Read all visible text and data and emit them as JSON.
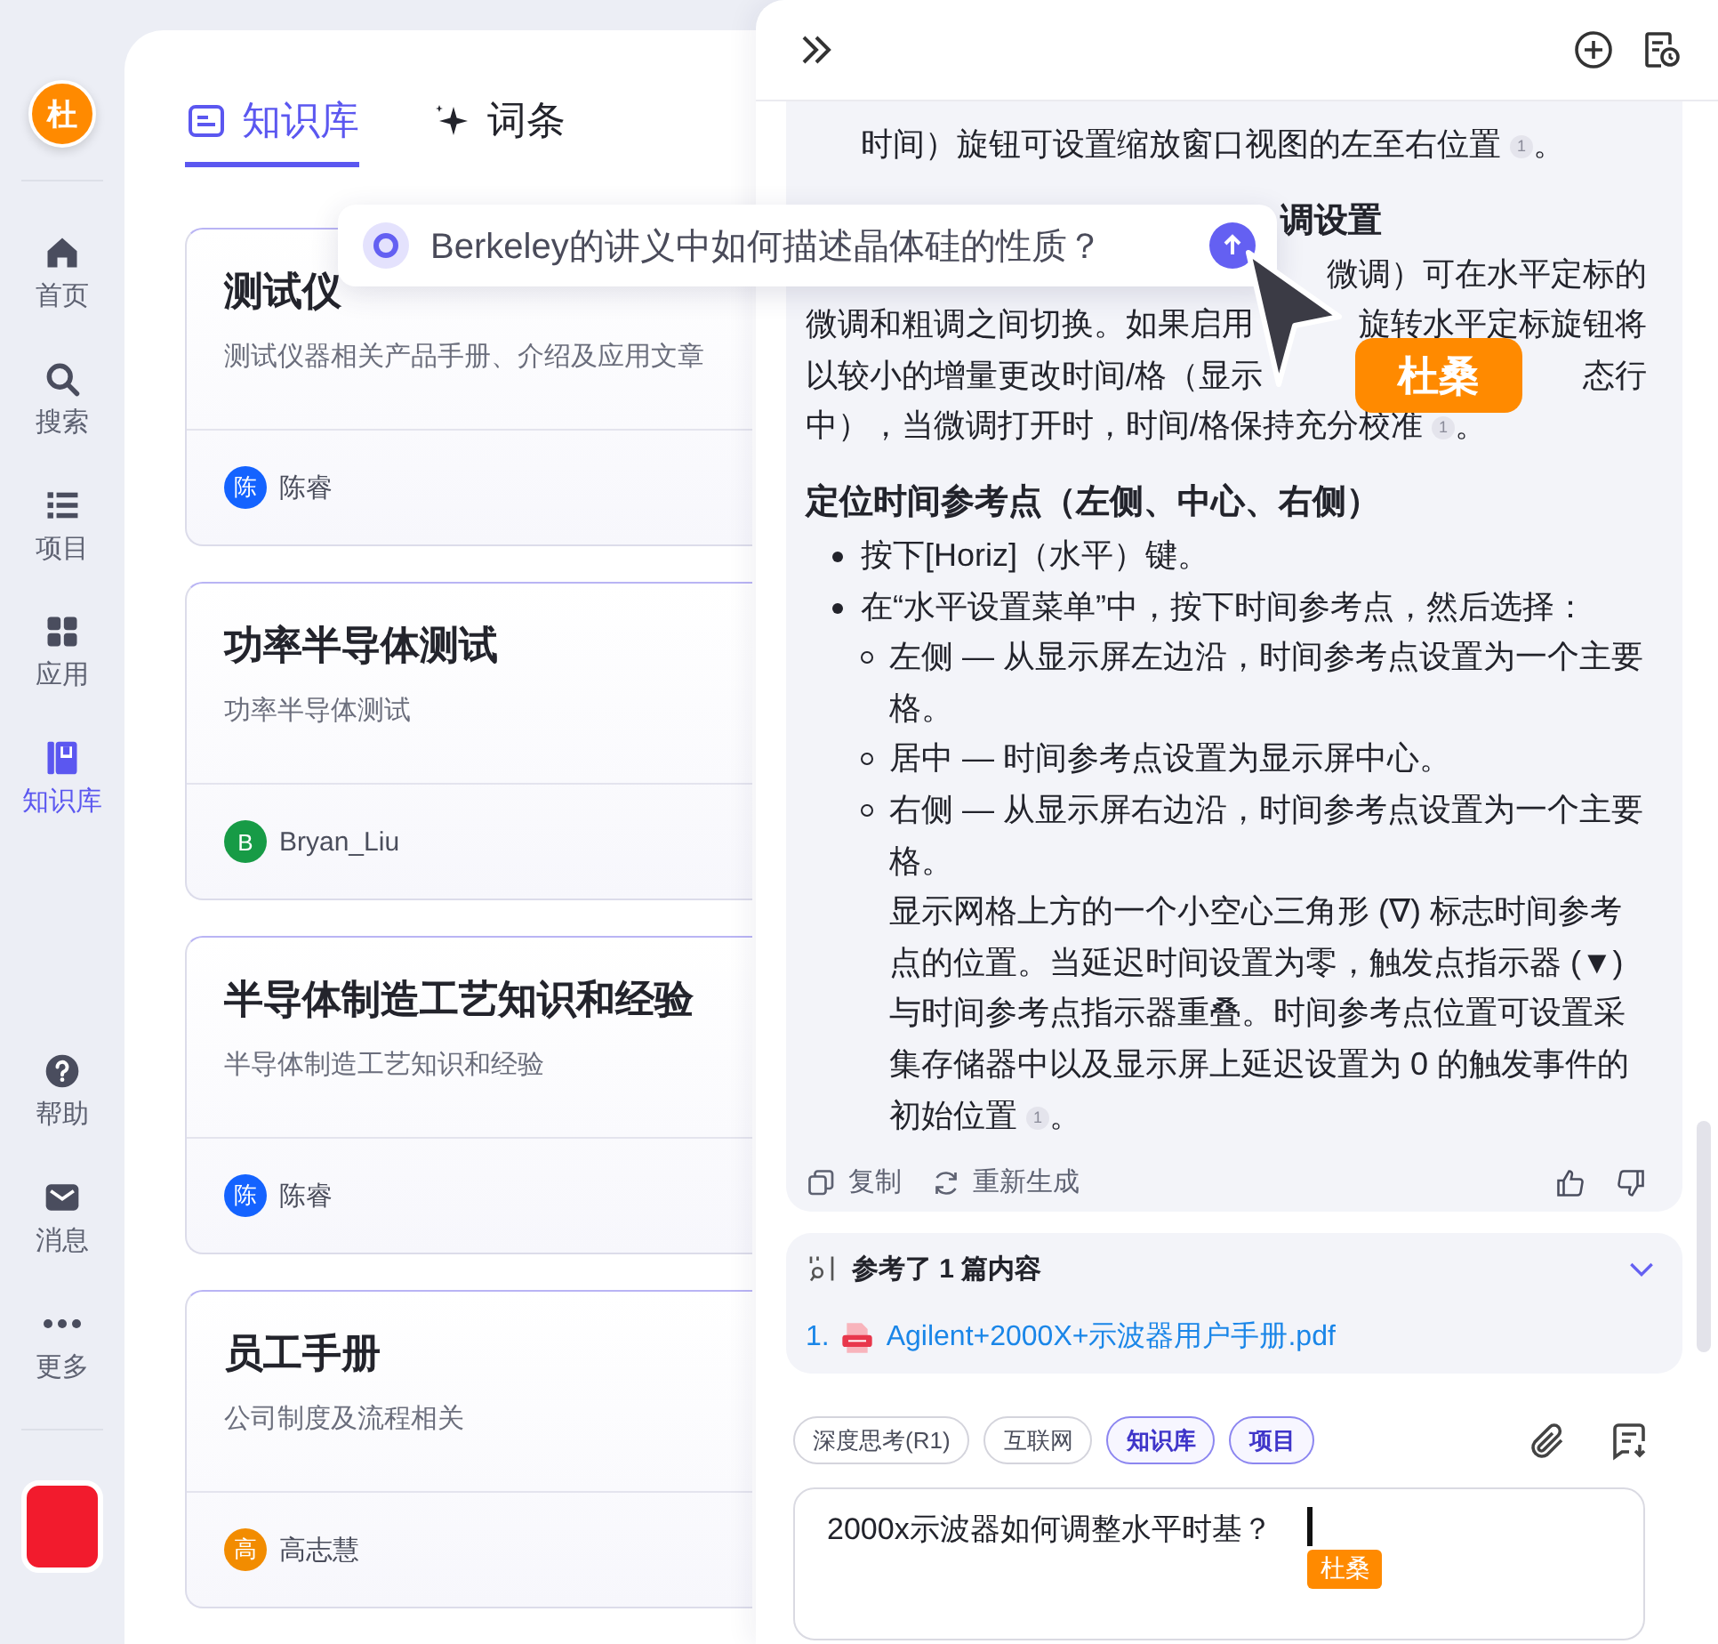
{
  "nav": {
    "avatar": "杜",
    "items": [
      {
        "label": "首页",
        "selected": false
      },
      {
        "label": "搜索",
        "selected": false
      },
      {
        "label": "项目",
        "selected": false
      },
      {
        "label": "应用",
        "selected": false
      },
      {
        "label": "知识库",
        "selected": true
      }
    ],
    "bottom_items": [
      {
        "label": "帮助",
        "selected": false
      },
      {
        "label": "消息",
        "selected": false
      },
      {
        "label": "更多",
        "selected": false
      }
    ]
  },
  "main": {
    "tabs": [
      {
        "label": "知识库",
        "selected": true
      },
      {
        "label": "词条",
        "selected": false
      }
    ],
    "cards": [
      {
        "title": "测试仪",
        "description": "测试仪器相关产品手册、介绍及应用文章",
        "owner_initial": "陈",
        "owner": "陈睿",
        "color": "#1463ff"
      },
      {
        "title": "功率半导体测试",
        "description": "功率半导体测试",
        "owner_initial": "B",
        "owner": "Bryan_Liu",
        "color": "#179b46"
      },
      {
        "title": "半导体制造工艺知识和经验",
        "description": "半导体制造工艺知识和经验",
        "owner_initial": "陈",
        "owner": "陈睿",
        "color": "#1463ff"
      },
      {
        "title": "员工手册",
        "description": "公司制度及流程相关",
        "owner_initial": "高",
        "owner": "高志慧",
        "color": "#f28c00"
      }
    ]
  },
  "popup": {
    "query": "Berkeley的讲义中如何描述晶体硅的性质？"
  },
  "pointer": {
    "name": "杜桑"
  },
  "chat": {
    "blocks": [
      {
        "kind": "cont",
        "text": "时间）旋钮可设置缩放窗口视图的左至右位置",
        "cite": "1",
        "tail": "。"
      },
      {
        "kind": "heading_tail",
        "text": "调设置"
      },
      {
        "kind": "lines",
        "lines": [
          {
            "kind": "tail",
            "pieces": [
              "微调）可在水平定标的"
            ]
          },
          {
            "kind": "full",
            "pieces": [
              "微调和粗调之间切换。如果启用",
              "旋转水平定标旋钮将"
            ]
          },
          {
            "kind": "full",
            "pieces": [
              "以较小的增量更改时间/格（显示",
              "态行"
            ]
          },
          {
            "kind": "full",
            "pieces": [
              "中），当微调打开时，时间/格保持充分校准"
            ],
            "cite": "1",
            "tail": "。"
          }
        ]
      },
      {
        "kind": "heading",
        "text": "定位时间参考点（左侧、中心、右侧）"
      },
      {
        "kind": "bullet",
        "text": "按下[Horiz]（水平）键。"
      },
      {
        "kind": "bullet",
        "text": "在“水平设置菜单”中，按下时间参考点，然后选择：",
        "children": [
          {
            "text": "左侧 — 从显示屏左边沿，时间参考点设置为一个主要格。"
          },
          {
            "text": "居中 — 时间参考点设置为显示屏中心。"
          },
          {
            "text": "右侧 — 从显示屏右边沿，时间参考点设置为一个主要格。",
            "note": [
              "显示网格上方的一个小空心三角形 (∇) 标志时间参考点的位置。当延迟时间设置为零，触发点指示器 (▼) 与时间参考点指示器重叠。时间参考点位置可设置采集存储器中以及显示屏上延迟设置为 0 的触发事件的",
              "初始位置"
            ],
            "cite": "1",
            "tail": "。"
          }
        ]
      }
    ],
    "actions": [
      {
        "label": "复制"
      },
      {
        "label": "重新生成"
      }
    ],
    "references": {
      "title": "参考了 1 篇内容",
      "expanded": true,
      "items": [
        {
          "index": "1.",
          "file": "Agilent+2000X+示波器用户手册.pdf"
        }
      ]
    },
    "chips": [
      {
        "label": "深度思考(R1)",
        "selected": false
      },
      {
        "label": "互联网",
        "selected": false
      },
      {
        "label": "知识库",
        "selected": true
      },
      {
        "label": "项目",
        "selected": true
      }
    ],
    "input": {
      "value": "2000x示波器如何调整水平时基？",
      "collaborator": "杜桑"
    }
  }
}
